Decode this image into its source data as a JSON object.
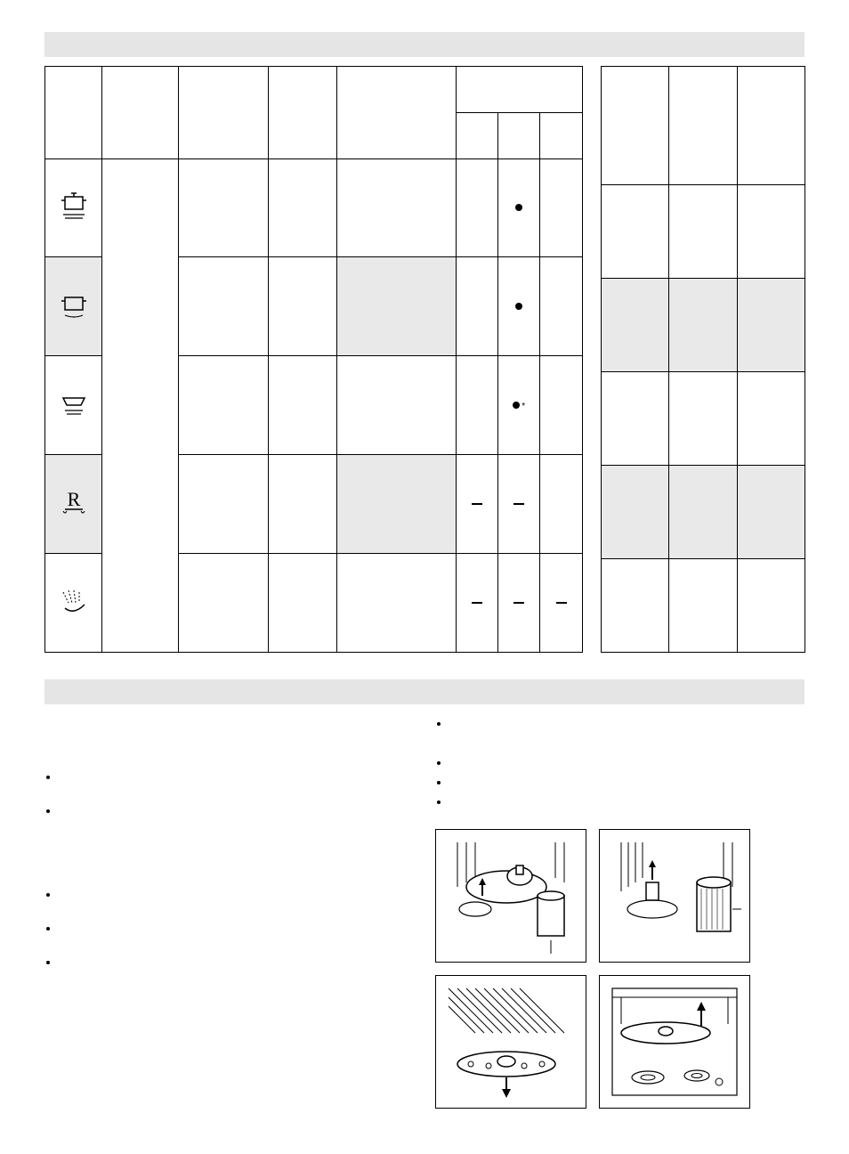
{
  "section1_title": "",
  "section2_title": "",
  "main_table": {
    "headers": [
      "",
      "",
      "",
      "",
      "",
      "",
      "",
      ""
    ],
    "sub_headers": [
      "",
      "",
      ""
    ],
    "rows": [
      {
        "icon": "pot-heavy",
        "shade": false,
        "c1": "",
        "c2": "",
        "c3": "",
        "c4": "",
        "d1": "",
        "d2": "dot",
        "d3": ""
      },
      {
        "icon": "pot-normal",
        "shade": true,
        "c1": "",
        "c2": "",
        "c3": "",
        "c4": "",
        "d1": "",
        "d2": "dot",
        "d3": ""
      },
      {
        "icon": "plates",
        "shade": false,
        "c1": "",
        "c2": "",
        "c3": "",
        "c4": "",
        "d1": "",
        "d2": "dot-star",
        "d3": ""
      },
      {
        "icon": "rinse-R",
        "shade": true,
        "c1": "",
        "c2": "",
        "c3": "",
        "c4": "",
        "d1": "dash",
        "d2": "dash",
        "d3": ""
      },
      {
        "icon": "spray",
        "shade": false,
        "c1": "",
        "c2": "",
        "c3": "",
        "c4": "",
        "d1": "dash",
        "d2": "dash",
        "d3": "dash"
      }
    ]
  },
  "side_table": {
    "headers": [
      "",
      "",
      ""
    ],
    "rows": [
      {
        "shade": false,
        "a": "",
        "b": "",
        "c": ""
      },
      {
        "shade": true,
        "a": "",
        "b": "",
        "c": ""
      },
      {
        "shade": false,
        "a": "",
        "b": "",
        "c": ""
      },
      {
        "shade": true,
        "a": "",
        "b": "",
        "c": ""
      },
      {
        "shade": false,
        "a": "",
        "b": "",
        "c": ""
      }
    ]
  },
  "left_bullets": [
    "",
    "",
    "",
    "",
    ""
  ],
  "right_bullets": [
    "",
    "",
    "",
    ""
  ],
  "figures": [
    "fig-filter-1",
    "fig-filter-2",
    "fig-spray-arm",
    "fig-arm-removal"
  ]
}
